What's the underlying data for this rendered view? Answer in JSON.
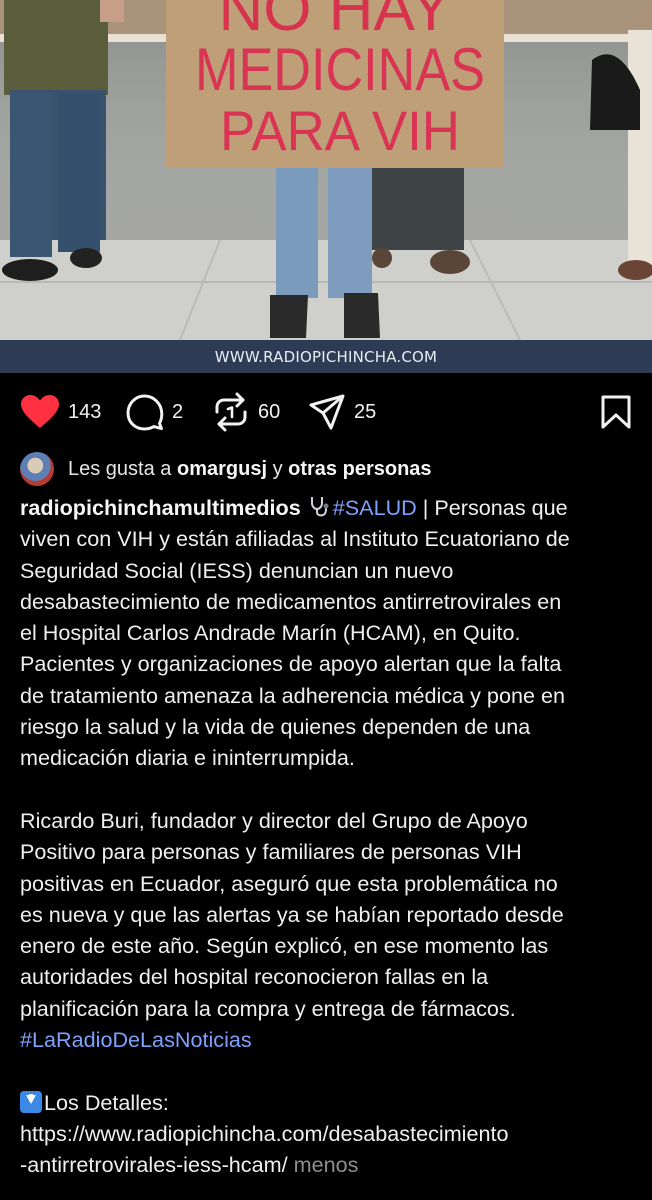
{
  "photo": {
    "sign_lines": [
      "NO HAY",
      "MEDICINAS",
      "PARA VIH"
    ],
    "watermark": "WWW.RADIOPICHINCHA.COM"
  },
  "actions": {
    "likes": "143",
    "comments": "2",
    "reposts": "60",
    "shares": "25"
  },
  "liked_by": {
    "prefix": "Les gusta a",
    "user": "omargusj",
    "connector": "y",
    "others": "otras personas"
  },
  "caption": {
    "username": "radiopichinchamultimedios",
    "tag_salud": "#SALUD",
    "p1_lines": [
      " | Personas que",
      "viven con VIH y están afiliadas al Instituto Ecuatoriano de",
      "Seguridad Social (IESS) denuncian un nuevo",
      "desabastecimiento de medicamentos antirretrovirales en",
      "el Hospital Carlos Andrade Marín (HCAM), en Quito.",
      "Pacientes y organizaciones de apoyo alertan que la falta",
      "de tratamiento amenaza la adherencia médica y pone en",
      "riesgo la salud y la vida de quienes dependen de una",
      "medicación diaria e ininterrumpida."
    ],
    "p2_lines": [
      "Ricardo Buri, fundador y director del Grupo de Apoyo",
      "Positivo para personas y familiares de personas VIH",
      "positivas en Ecuador, aseguró que esta problemática no",
      "es nueva y que las alertas ya se habían reportado desde",
      "enero de este año. Según explicó, en ese momento las",
      "autoridades del hospital reconocieron fallas en la",
      "planificación para la compra y entrega de fármacos."
    ],
    "tag_radio": "#LaRadioDeLasNoticias",
    "details_label": "Los Detalles:",
    "link_line1": "https://www.radiopichincha.com/desabastecimiento",
    "link_line2": "-antirretrovirales-iess-hcam/",
    "less": "menos"
  },
  "colors": {
    "like_red": "#ff3040",
    "hashtag_blue": "#7ea0ff",
    "banner_bg": "#2d3c54"
  },
  "icons": [
    "heart-icon",
    "comment-icon",
    "repost-icon",
    "send-icon",
    "bookmark-icon",
    "stethoscope-icon",
    "down-arrow-emoji"
  ]
}
